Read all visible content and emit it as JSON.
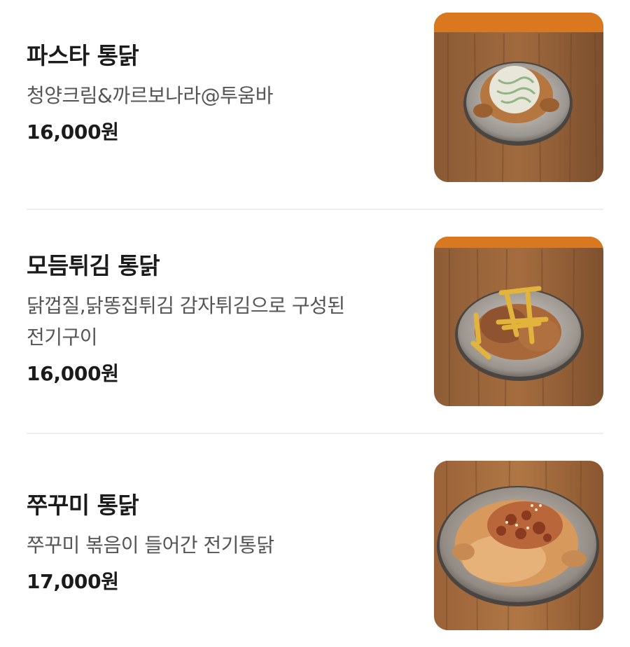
{
  "menu": {
    "items": [
      {
        "title": "파스타 통닭",
        "desc": [
          "청양크림&까르보나라@투움바"
        ],
        "price": "16,000원",
        "image": "pasta-chicken-photo"
      },
      {
        "title": "모듬튀김 통닭",
        "desc": [
          "닭껍질,닭똥집튀김 감자튀김으로 구성된",
          "전기구이"
        ],
        "price": "16,000원",
        "image": "fried-assortment-chicken-photo"
      },
      {
        "title": "쭈꾸미 통닭",
        "desc": [
          "쭈꾸미 볶음이 들어간 전기통닭"
        ],
        "price": "17,000원",
        "image": "webfoot-octopus-chicken-photo"
      }
    ]
  }
}
